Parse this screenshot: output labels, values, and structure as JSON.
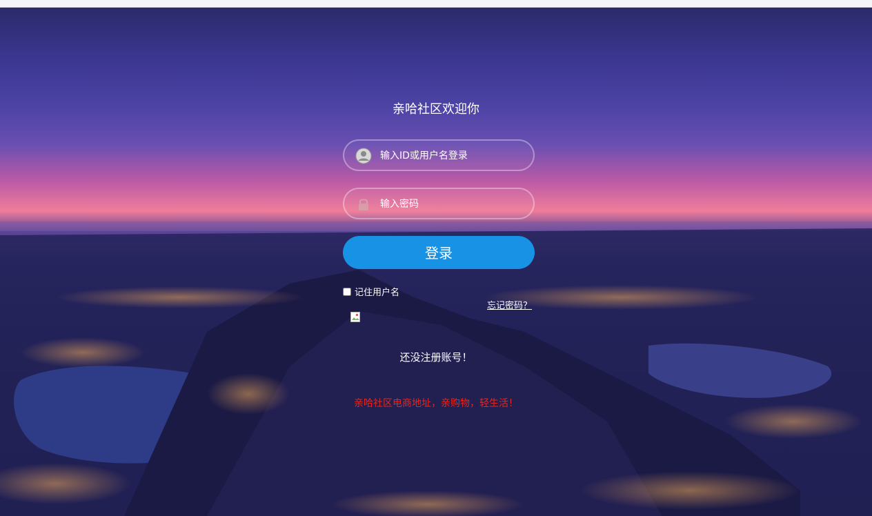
{
  "header": {
    "title": "亲哈社区欢迎你"
  },
  "login_form": {
    "username_placeholder": "输入ID或用户名登录",
    "password_placeholder": "输入密码",
    "login_label": "登录",
    "remember_label": "记住用户名",
    "remember_checked": false,
    "forgot_label": "忘记密码？"
  },
  "register": {
    "label": "还没注册账号！"
  },
  "footer": {
    "slogan": "亲哈社区电商地址，亲购物，轻生活！"
  },
  "icons": {
    "user": "user-icon",
    "lock": "lock-icon",
    "broken_image": "broken-image-icon"
  },
  "colors": {
    "login_button": "#1792e4",
    "slogan": "#e8251c",
    "text": "#ffffff"
  }
}
